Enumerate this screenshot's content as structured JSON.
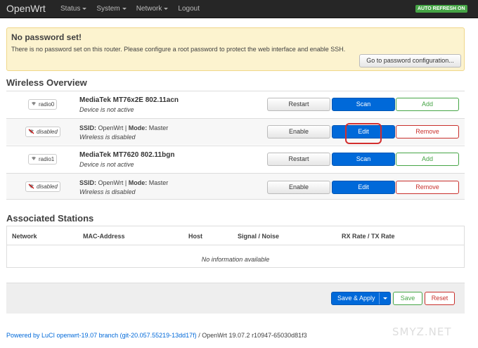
{
  "navbar": {
    "brand": "OpenWrt",
    "menu": [
      "Status",
      "System",
      "Network",
      "Logout"
    ],
    "auto_refresh": "AUTO REFRESH ON"
  },
  "alert": {
    "title": "No password set!",
    "message": "There is no password set on this router. Please configure a root password to protect the web interface and enable SSH.",
    "button": "Go to password configuration..."
  },
  "wireless": {
    "heading": "Wireless Overview",
    "rows": [
      {
        "badge": "radio0",
        "title": "MediaTek MT76x2E 802.11acn",
        "sub": "Device is not active",
        "buttons": [
          "Restart",
          "Scan",
          "Add"
        ]
      },
      {
        "badge": "disabled",
        "ssid_label": "SSID:",
        "ssid": "OpenWrt",
        "sep": "|",
        "mode_label": "Mode:",
        "mode": "Master",
        "sub": "Wireless is disabled",
        "buttons": [
          "Enable",
          "Edit",
          "Remove"
        ]
      },
      {
        "badge": "radio1",
        "title": "MediaTek MT7620 802.11bgn",
        "sub": "Device is not active",
        "buttons": [
          "Restart",
          "Scan",
          "Add"
        ]
      },
      {
        "badge": "disabled",
        "ssid_label": "SSID:",
        "ssid": "OpenWrt",
        "sep": "|",
        "mode_label": "Mode:",
        "mode": "Master",
        "sub": "Wireless is disabled",
        "buttons": [
          "Enable",
          "Edit",
          "Remove"
        ]
      }
    ]
  },
  "associated": {
    "heading": "Associated Stations",
    "columns": [
      "Network",
      "MAC-Address",
      "Host",
      "Signal / Noise",
      "RX Rate / TX Rate"
    ],
    "empty": "No information available"
  },
  "actions": {
    "save_apply": "Save & Apply",
    "save": "Save",
    "reset": "Reset"
  },
  "footer": {
    "link": "Powered by LuCI openwrt-19.07 branch (git-20.057.55219-13dd17f)",
    "rest": " / OpenWrt 19.07.2 r10947-65030d81f3"
  },
  "watermark": "SMYZ.NET"
}
